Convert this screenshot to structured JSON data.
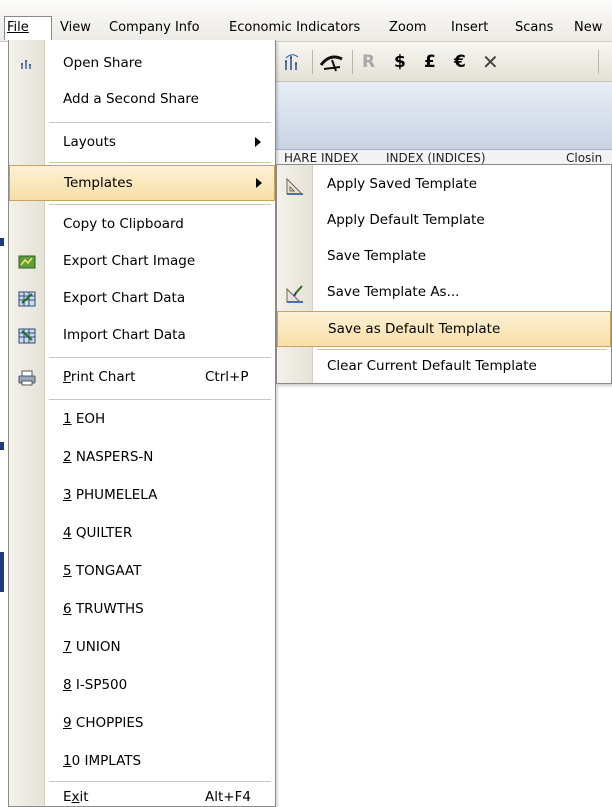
{
  "menubar": {
    "items": [
      {
        "label": "File",
        "access": "F"
      },
      {
        "label": "View",
        "access": "V"
      },
      {
        "label": "Company Info"
      },
      {
        "label": "Economic Indicators"
      },
      {
        "label": "Zoom"
      },
      {
        "label": "Insert"
      },
      {
        "label": "Scans"
      },
      {
        "label": "New"
      }
    ]
  },
  "toolbar": {
    "r_label": "R",
    "dollar_label": "$",
    "pound_label": "£",
    "euro_label": "€",
    "close_label": "✕"
  },
  "column_headers": [
    "HARE INDEX",
    "INDEX (INDICES)",
    "Closin"
  ],
  "file_menu": {
    "open_share": "Open Share",
    "add_second_share": "Add a Second Share",
    "layouts": "Layouts",
    "templates": "Templates",
    "copy_clipboard": "Copy to Clipboard",
    "export_image": "Export Chart Image",
    "export_data": "Export Chart Data",
    "import_data": "Import Chart Data",
    "print_chart": {
      "access": "P",
      "rest": "rint Chart",
      "shortcut": "Ctrl+P"
    },
    "recent": [
      {
        "num": "1",
        "name": "EOH"
      },
      {
        "num": "2",
        "name": "NASPERS-N"
      },
      {
        "num": "3",
        "name": "PHUMELELA"
      },
      {
        "num": "4",
        "name": "QUILTER"
      },
      {
        "num": "5",
        "name": "TONGAAT"
      },
      {
        "num": "6",
        "name": "TRUWTHS"
      },
      {
        "num": "7",
        "name": "UNION"
      },
      {
        "num": "8",
        "name": "I-SP500"
      },
      {
        "num": "9",
        "name": "CHOPPIES"
      },
      {
        "num": "1",
        "name": "IMPLATS",
        "num_rest": "0"
      }
    ],
    "exit": {
      "pre": "E",
      "access": "x",
      "rest": "it",
      "shortcut": "Alt+F4"
    }
  },
  "templates_submenu": {
    "apply_saved": "Apply Saved Template",
    "apply_default": "Apply Default Template",
    "save_template": "Save Template",
    "save_as": "Save Template As...",
    "save_default": "Save as Default Template",
    "clear_default": "Clear Current Default Template"
  },
  "colors": {
    "highlight_top": "#fdf1d5",
    "highlight_bottom": "#f7dfa7",
    "highlight_border": "#c9a55a",
    "menu_border": "#8a8a8a"
  }
}
